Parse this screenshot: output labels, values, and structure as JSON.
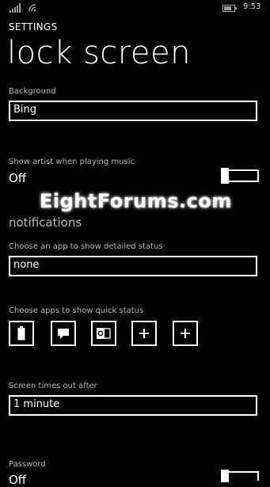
{
  "status": {
    "time": "9:53"
  },
  "app_title": "SETTINGS",
  "page_title": "lock screen",
  "background": {
    "label": "Background",
    "value": "Bing"
  },
  "show_artist": {
    "label": "Show artist when playing music",
    "state": "Off"
  },
  "watermark": "EightForums.com",
  "notifications": {
    "heading": "notifications",
    "detailed_label": "Choose an app to show detailed status",
    "detailed_value": "none",
    "quick_label": "Choose apps to show quick status",
    "quick_icons": [
      "battery-icon",
      "message-icon",
      "outlook-icon",
      "plus-icon",
      "plus-icon"
    ]
  },
  "timeout": {
    "label": "Screen times out after",
    "value": "1 minute"
  },
  "password": {
    "label": "Password",
    "state": "Off"
  }
}
